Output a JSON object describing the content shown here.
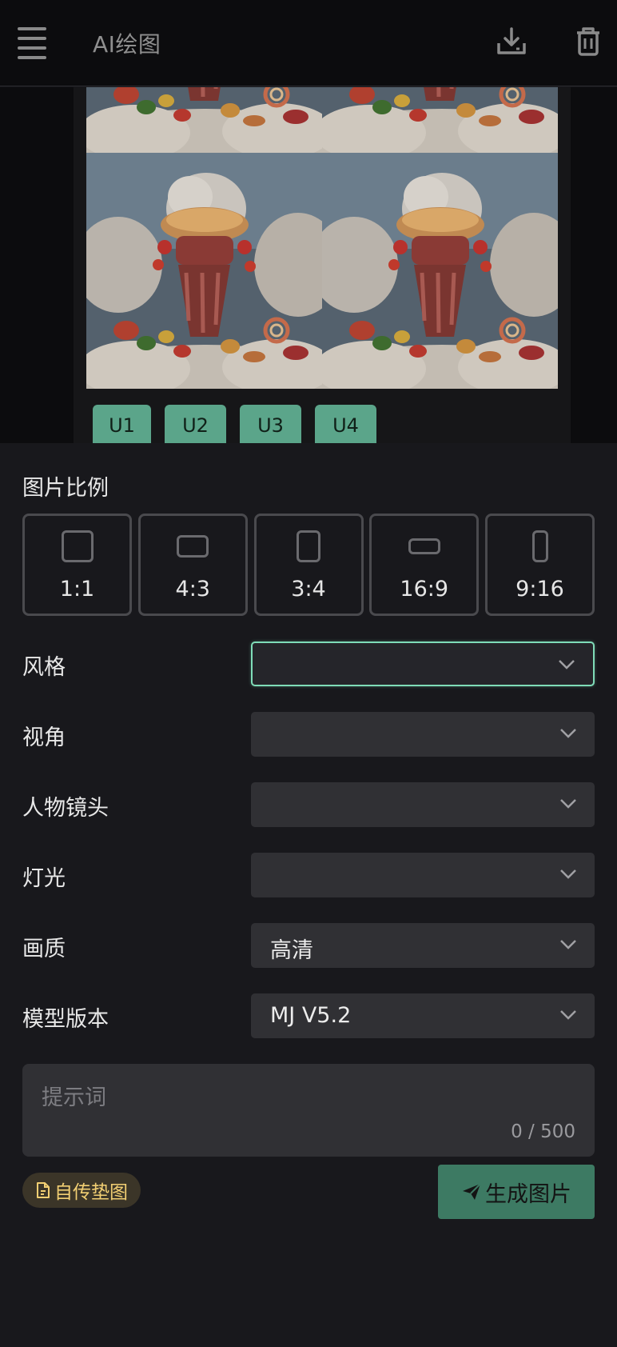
{
  "header": {
    "title": "AI绘图",
    "icons": [
      "menu-icon",
      "download-icon",
      "trash-icon"
    ]
  },
  "upscale_buttons": [
    "U1",
    "U2",
    "U3",
    "U4"
  ],
  "ratio": {
    "label": "图片比例",
    "options": [
      "1:1",
      "4:3",
      "3:4",
      "16:9",
      "9:16"
    ]
  },
  "fields": {
    "style": {
      "label": "风格",
      "value": ""
    },
    "view": {
      "label": "视角",
      "value": ""
    },
    "shot": {
      "label": "人物镜头",
      "value": ""
    },
    "light": {
      "label": "灯光",
      "value": ""
    },
    "quality": {
      "label": "画质",
      "value": "高清"
    },
    "model": {
      "label": "模型版本",
      "value": "MJ V5.2"
    }
  },
  "prompt": {
    "placeholder": "提示词",
    "counter": "0 / 500"
  },
  "actions": {
    "upload_label": "自传垫图",
    "generate_label": "生成图片"
  },
  "colors": {
    "accent": "#5ba58a",
    "generate": "#3d7a63",
    "upload_text": "#f2cf73",
    "focus_border": "#7fdcb8"
  }
}
